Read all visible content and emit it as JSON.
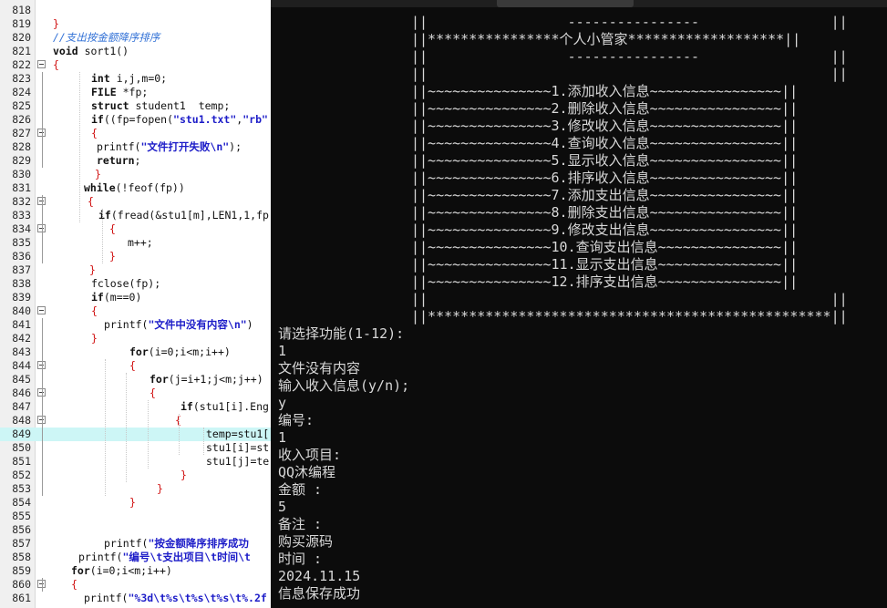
{
  "editor": {
    "lines": [
      {
        "num": "818",
        "text": ""
      },
      {
        "num": "819",
        "text": "}"
      },
      {
        "num": "820",
        "text": "//支出按金额降序排序"
      },
      {
        "num": "821",
        "text": "void sort1()"
      },
      {
        "num": "822",
        "text": "{"
      },
      {
        "num": "823",
        "text": "int i,j,m=0;"
      },
      {
        "num": "824",
        "text": "FILE *fp;"
      },
      {
        "num": "825",
        "text": "struct student1  temp;"
      },
      {
        "num": "826",
        "text": "if((fp=fopen(\"stu1.txt\",\"rb\""
      },
      {
        "num": "827",
        "text": "{"
      },
      {
        "num": "828",
        "text": "printf(\"文件打开失败\\n\");"
      },
      {
        "num": "829",
        "text": "return;"
      },
      {
        "num": "830",
        "text": "}"
      },
      {
        "num": "831",
        "text": "while(!feof(fp))"
      },
      {
        "num": "832",
        "text": "{"
      },
      {
        "num": "833",
        "text": "if(fread(&stu1[m],LEN1,1,fp"
      },
      {
        "num": "834",
        "text": "{"
      },
      {
        "num": "835",
        "text": "m++;"
      },
      {
        "num": "836",
        "text": "}"
      },
      {
        "num": "837",
        "text": "}"
      },
      {
        "num": "838",
        "text": "fclose(fp);"
      },
      {
        "num": "839",
        "text": "if(m==0)"
      },
      {
        "num": "840",
        "text": "{"
      },
      {
        "num": "841",
        "text": "printf(\"文件中没有内容\\n\")"
      },
      {
        "num": "842",
        "text": "}"
      },
      {
        "num": "843",
        "text": "for(i=0;i<m;i++)"
      },
      {
        "num": "844",
        "text": "{"
      },
      {
        "num": "845",
        "text": "for(j=i+1;j<m;j++)"
      },
      {
        "num": "846",
        "text": "{"
      },
      {
        "num": "847",
        "text": "if(stu1[i].Eng"
      },
      {
        "num": "848",
        "text": "{"
      },
      {
        "num": "849",
        "text": "temp=stu1["
      },
      {
        "num": "850",
        "text": "stu1[i]=st"
      },
      {
        "num": "851",
        "text": "stu1[j]=te"
      },
      {
        "num": "852",
        "text": "}"
      },
      {
        "num": "853",
        "text": "}"
      },
      {
        "num": "854",
        "text": "}"
      },
      {
        "num": "855",
        "text": ""
      },
      {
        "num": "856",
        "text": ""
      },
      {
        "num": "857",
        "text": "printf(\"按金额降序排序成功"
      },
      {
        "num": "858",
        "text": "printf(\"编号\\t支出项目\\t时间\\t"
      },
      {
        "num": "859",
        "text": "for(i=0;i<m;i++)"
      },
      {
        "num": "860",
        "text": "{"
      },
      {
        "num": "861",
        "text": "printf(\"%3d\\t%s\\t%s\\t%s\\t%.2f"
      }
    ]
  },
  "console": {
    "lines": [
      "||                 ----------------                ||",
      "||****************个人小管家*******************||",
      "||                 ----------------                ||",
      "||                                                 ||",
      "||~~~~~~~~~~~~~~~1.添加收入信息~~~~~~~~~~~~~~~~||",
      "||~~~~~~~~~~~~~~~2.删除收入信息~~~~~~~~~~~~~~~~||",
      "||~~~~~~~~~~~~~~~3.修改收入信息~~~~~~~~~~~~~~~~||",
      "||~~~~~~~~~~~~~~~4.查询收入信息~~~~~~~~~~~~~~~~||",
      "||~~~~~~~~~~~~~~~5.显示收入信息~~~~~~~~~~~~~~~~||",
      "||~~~~~~~~~~~~~~~6.排序收入信息~~~~~~~~~~~~~~~~||",
      "||~~~~~~~~~~~~~~~7.添加支出信息~~~~~~~~~~~~~~~~||",
      "||~~~~~~~~~~~~~~~8.删除支出信息~~~~~~~~~~~~~~~~||",
      "||~~~~~~~~~~~~~~~9.修改支出信息~~~~~~~~~~~~~~~~||",
      "||~~~~~~~~~~~~~~~10.查询支出信息~~~~~~~~~~~~~~~||",
      "||~~~~~~~~~~~~~~~11.显示支出信息~~~~~~~~~~~~~~~||",
      "||~~~~~~~~~~~~~~~12.排序支出信息~~~~~~~~~~~~~~~||",
      "||                                                 ||",
      "||*************************************************||",
      "请选择功能(1-12):",
      "1",
      "文件没有内容",
      "输入收入信息(y/n);",
      "y",
      "编号:",
      "1",
      "收入项目:",
      "QQ沐编程",
      "金额 :",
      "5",
      "备注 :",
      "购买源码",
      "时间 :",
      "2024.11.15",
      "信息保存成功"
    ]
  }
}
